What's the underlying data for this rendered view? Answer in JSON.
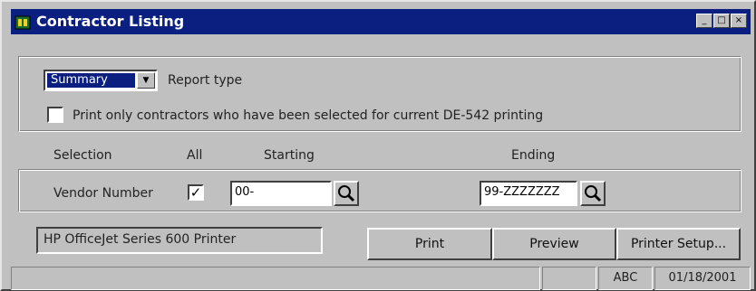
{
  "window": {
    "title": "Contractor Listing",
    "icon": "app-icon",
    "controls": {
      "minimize": "_",
      "maximize": "□",
      "close": "×"
    }
  },
  "report": {
    "type_value": "Summary",
    "type_label": "Report type",
    "print_selected_label": "Print only contractors who have been selected for current DE-542 printing",
    "print_selected_checked": false
  },
  "selection": {
    "headers": {
      "selection": "Selection",
      "all": "All",
      "starting": "Starting",
      "ending": "Ending"
    },
    "row_label": "Vendor Number",
    "all_checked": true,
    "all_mark": "✓",
    "starting_value": "00-",
    "ending_value": "99-ZZZZZZZ"
  },
  "printer": {
    "name": "HP OfficeJet Series 600 Printer"
  },
  "buttons": {
    "print": "Print",
    "preview": "Preview",
    "printer_setup": "Printer Setup..."
  },
  "status": {
    "company": "ABC",
    "date": "01/18/2001"
  },
  "colors": {
    "title_bar": "#0a1f80",
    "window_bg": "#c0c0c0"
  }
}
